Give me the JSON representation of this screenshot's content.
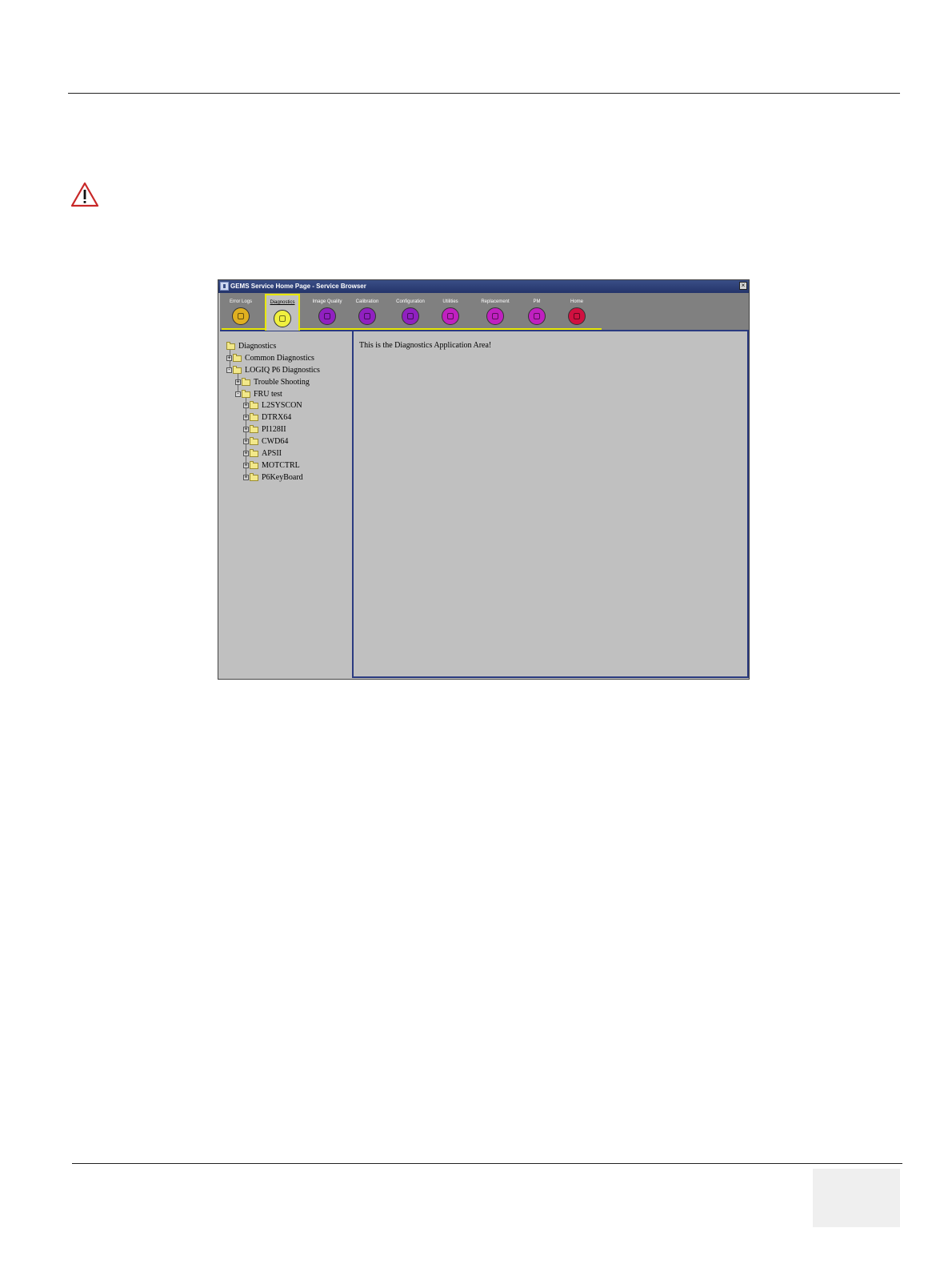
{
  "window": {
    "title": "GEMS Service Home Page - Service Browser",
    "close_glyph": "×"
  },
  "toolbar": {
    "items": [
      {
        "label": "Error Logs",
        "color": "#e0b020",
        "icon": "list-icon"
      },
      {
        "label": "Diagnostics",
        "color": "#f0f040",
        "icon": "diagnostics-icon",
        "active": true
      },
      {
        "label": "Image Quality",
        "color": "#9020c0",
        "icon": "image-icon"
      },
      {
        "label": "Calibration",
        "color": "#9020c0",
        "icon": "calibration-icon"
      },
      {
        "label": "Configuration",
        "color": "#9020c0",
        "icon": "configuration-icon"
      },
      {
        "label": "Utilities",
        "color": "#c020c0",
        "icon": "utilities-icon"
      },
      {
        "label": "Replacement",
        "color": "#c020c0",
        "icon": "replacement-icon"
      },
      {
        "label": "PM",
        "color": "#c020c0",
        "icon": "pm-icon"
      },
      {
        "label": "Home",
        "color": "#d01040",
        "icon": "home-icon"
      }
    ]
  },
  "tree": {
    "root": "Diagnostics",
    "items": [
      {
        "label": "Common Diagnostics",
        "expander": "+"
      },
      {
        "label": "LOGIQ P6 Diagnostics",
        "expander": "-"
      },
      {
        "label": "Trouble Shooting",
        "expander": "+"
      },
      {
        "label": "FRU test",
        "expander": "-"
      },
      {
        "label": "L2SYSCON",
        "expander": "+"
      },
      {
        "label": "DTRX64",
        "expander": "+"
      },
      {
        "label": "PI128II",
        "expander": "+"
      },
      {
        "label": "CWD64",
        "expander": "+"
      },
      {
        "label": "APSII",
        "expander": "+"
      },
      {
        "label": "MOTCTRL",
        "expander": "+"
      },
      {
        "label": "P6KeyBoard",
        "expander": "+"
      }
    ]
  },
  "app_area": {
    "text": "This is the Diagnostics Application Area!"
  }
}
